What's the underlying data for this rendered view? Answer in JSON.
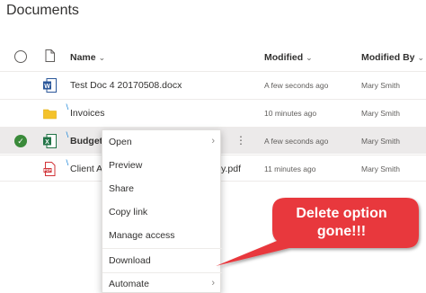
{
  "page": {
    "title": "Documents"
  },
  "columns": {
    "name": "Name",
    "modified": "Modified",
    "modified_by": "Modified By"
  },
  "files": [
    {
      "name": "Test Doc 4 20170508.docx",
      "type": "word",
      "modified": "A few seconds ago",
      "modified_by": "Mary Smith",
      "selected": false
    },
    {
      "name": "Invoices",
      "type": "folder",
      "modified": "10 minutes ago",
      "modified_by": "Mary Smith",
      "selected": false
    },
    {
      "name": "Budget.",
      "type": "excel",
      "modified": "A few seconds ago",
      "modified_by": "Mary Smith",
      "selected": true
    },
    {
      "name_prefix": "Client A",
      "name_suffix": "y.pdf",
      "type": "pdf",
      "modified": "11 minutes ago",
      "modified_by": "Mary Smith",
      "selected": false
    }
  ],
  "context_menu": {
    "items": [
      {
        "label": "Open",
        "submenu": true
      },
      {
        "label": "Preview",
        "submenu": false
      },
      {
        "label": "Share",
        "submenu": false
      },
      {
        "label": "Copy link",
        "submenu": false
      },
      {
        "label": "Manage access",
        "submenu": false
      },
      {
        "label": "Download",
        "submenu": false
      },
      {
        "label": "Automate",
        "submenu": true
      }
    ]
  },
  "callout": {
    "line1": "Delete option",
    "line2": "gone!!!",
    "color": "#e8383d"
  },
  "colors": {
    "word": "#2b579a",
    "excel": "#217346",
    "pdf": "#d13438",
    "folder": "#f4c22b",
    "selected_check": "#3a8a3a"
  },
  "icons": {
    "checkbox_header": "circle-outline",
    "file_header": "document-outline",
    "selected_check": "✓",
    "chevron": "⌄",
    "submenu_arrow": "›",
    "more": "⋮"
  }
}
